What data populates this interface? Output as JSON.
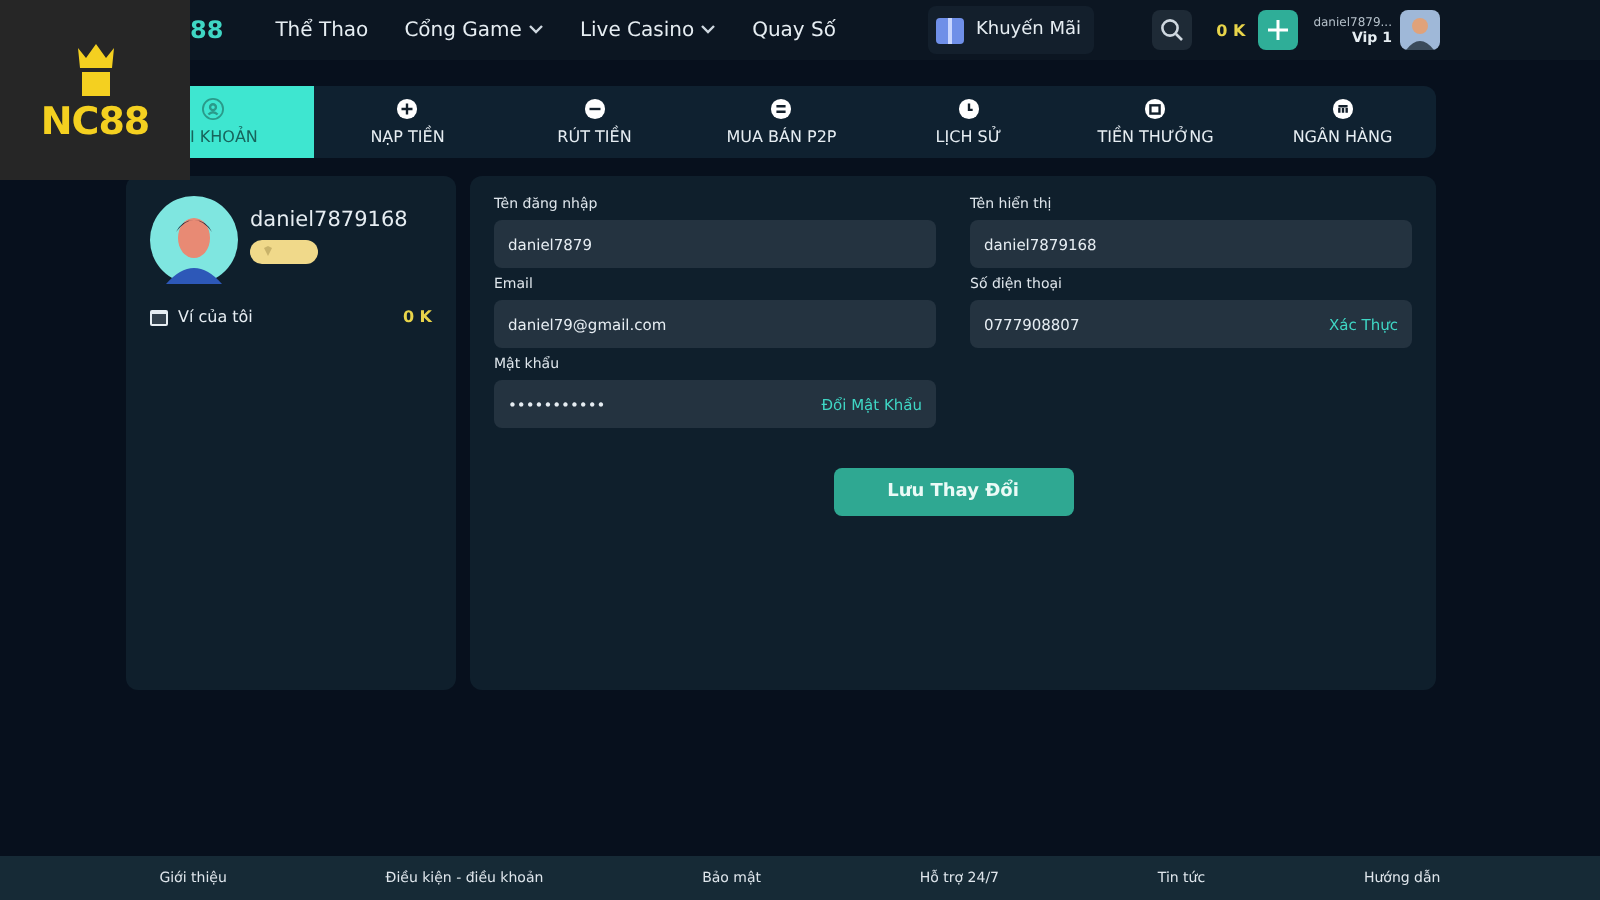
{
  "logo": {
    "text": "NC88"
  },
  "header": {
    "brand": "88",
    "nav": [
      {
        "label": "Thể Thao",
        "dropdown": false
      },
      {
        "label": "Cổng Game",
        "dropdown": true
      },
      {
        "label": "Live Casino",
        "dropdown": true
      },
      {
        "label": "Quay Số",
        "dropdown": false
      }
    ],
    "promo": "Khuyến Mãi",
    "balance": "0 K",
    "username": "daniel7879...",
    "vip": "Vip 1"
  },
  "tabs": [
    {
      "label": "I KHOẢN",
      "selected": true
    },
    {
      "label": "NẠP TIỀN",
      "selected": false
    },
    {
      "label": "RÚT TIỀN",
      "selected": false
    },
    {
      "label": "MUA BÁN P2P",
      "selected": false
    },
    {
      "label": "LỊCH SỬ",
      "selected": false
    },
    {
      "label": "TIỀN THƯỞNG",
      "selected": false
    },
    {
      "label": "NGÂN HÀNG",
      "selected": false
    }
  ],
  "profile": {
    "name": "daniel7879168",
    "wallet_label": "Ví của tôi",
    "wallet_amount": "0 K"
  },
  "fields": [
    {
      "label": "Tên đăng nhập",
      "value": "daniel7879"
    },
    {
      "label": "Tên hiển thị",
      "value": "daniel7879168"
    },
    {
      "label": "Email",
      "value": "daniel79@gmail.com"
    },
    {
      "label": "Số điện thoại",
      "value": "0777908807",
      "action": "Xác Thực"
    },
    {
      "label": "Mật khẩu",
      "value": "•••••••••••",
      "action": "Đổi Mật Khẩu"
    }
  ],
  "save_button": "Lưu Thay Đổi",
  "footer": [
    "Giới thiệu",
    "Điều kiện - điều khoản",
    "Bảo mật",
    "Hỗ trợ 24/7",
    "Tin tức",
    "Hướng dẫn"
  ]
}
